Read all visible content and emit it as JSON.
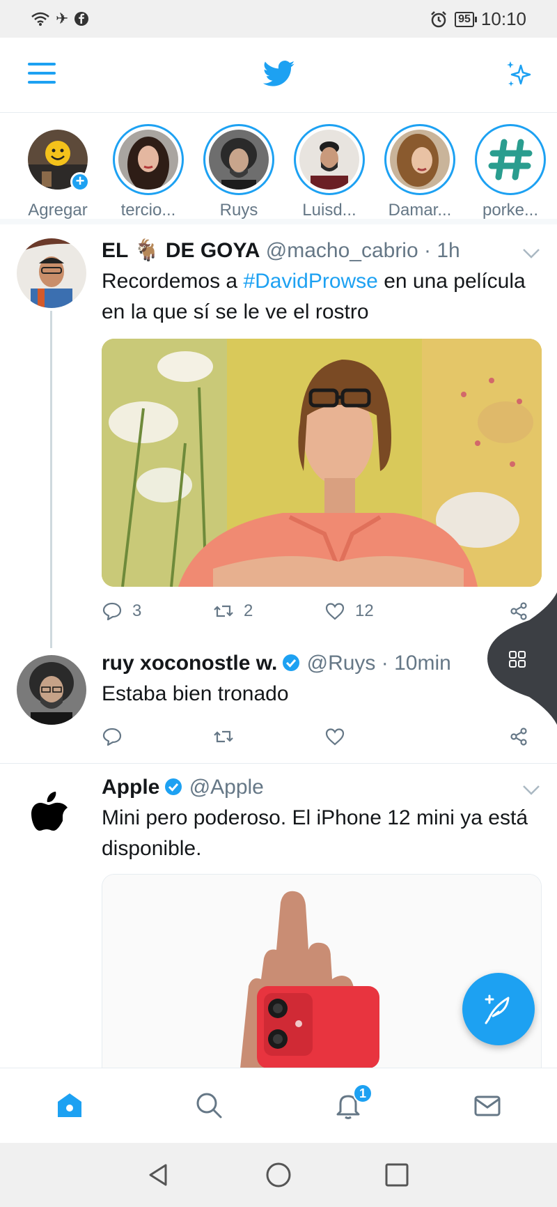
{
  "status_bar": {
    "battery": "95",
    "time": "10:10"
  },
  "fleets": [
    {
      "label": "Agregar"
    },
    {
      "label": "tercio..."
    },
    {
      "label": "Ruys"
    },
    {
      "label": "Luisd..."
    },
    {
      "label": "Damar..."
    },
    {
      "label": "porke..."
    }
  ],
  "tweets": [
    {
      "name": "EL 🐐 DE GOYA",
      "handle": "@macho_cabrio",
      "time": "· 1h",
      "text_before": "Recordemos a ",
      "hashtag": "#DavidProwse",
      "text_after": " en una película en la que sí se le ve el rostro",
      "replies": "3",
      "retweets": "2",
      "likes": "12"
    },
    {
      "name": "ruy xoconostle w.",
      "handle": "@Ruys",
      "time": "· 10min",
      "text": "Estaba bien tronado"
    },
    {
      "name": "Apple",
      "handle": "@Apple",
      "text": "Mini pero poderoso. El iPhone 12 mini ya está disponible."
    }
  ],
  "notifications_count": "1",
  "colors": {
    "accent": "#1da1f2",
    "text": "#14171a",
    "muted": "#657786"
  }
}
